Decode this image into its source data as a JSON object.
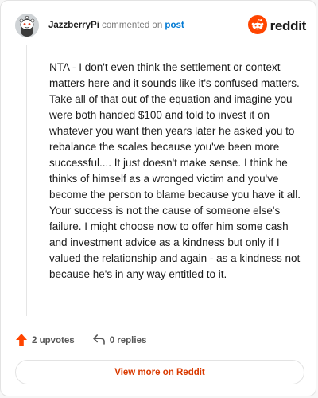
{
  "header": {
    "author": "JazzberryPi",
    "action_text": "commented on",
    "post_link": "post",
    "brand": "reddit",
    "avatar_icon": "snoo-avatar-icon",
    "brand_icon": "reddit-logo-icon"
  },
  "comment": {
    "body": "NTA - I don't even think the settlement or context matters here and it sounds like it's confused matters. Take all of that out of the equation and imagine you were both handed $100 and told to invest it on whatever you want then years later he asked you to rebalance the scales because you've been more successful.... It just doesn't make sense. I think he thinks of himself as a wronged victim and you've become the person to blame because you have it all. Your success is not the cause of someone else's failure. I might choose now to offer him some cash and investment advice as a kindness but only if I valued the relationship and again - as a kindness not because he's in any way entitled to it."
  },
  "footer": {
    "upvotes_label": "2 upvotes",
    "replies_label": "0 replies",
    "view_more_label": "View more on Reddit",
    "upvote_icon": "upvote-arrow-icon",
    "reply_icon": "reply-arrow-icon"
  },
  "colors": {
    "brand_orange": "#ff4500",
    "link_blue": "#0079d3",
    "view_more_text": "#d93a00"
  }
}
